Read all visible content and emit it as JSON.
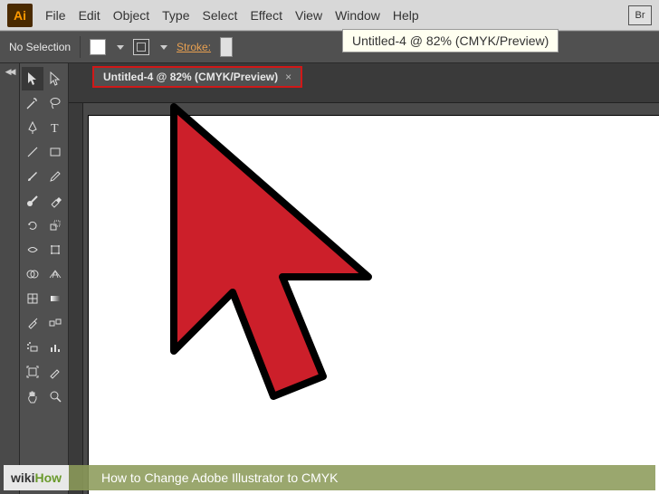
{
  "logo": "Ai",
  "menu": [
    "File",
    "Edit",
    "Object",
    "Type",
    "Select",
    "Effect",
    "View",
    "Window",
    "Help"
  ],
  "br_badge": "Br",
  "controlbar": {
    "selection_state": "No Selection",
    "stroke_label": "Stroke:"
  },
  "document": {
    "tab_title": "Untitled-4 @ 82% (CMYK/Preview)",
    "close_glyph": "×"
  },
  "tooltip": "Untitled-4 @ 82% (CMYK/Preview)",
  "caption": {
    "wiki_w": "wiki",
    "wiki_how": "How",
    "text": "How to Change Adobe Illustrator to CMYK"
  },
  "tools": [
    "selection",
    "direct-selection",
    "magic-wand",
    "lasso",
    "pen",
    "type",
    "line",
    "rectangle",
    "paintbrush",
    "pencil",
    "blob-brush",
    "eraser",
    "rotate",
    "scale",
    "width",
    "free-transform",
    "shape-builder",
    "perspective",
    "mesh",
    "gradient",
    "eyedropper",
    "blend",
    "symbol-sprayer",
    "column-graph",
    "artboard",
    "slice",
    "hand",
    "zoom"
  ]
}
